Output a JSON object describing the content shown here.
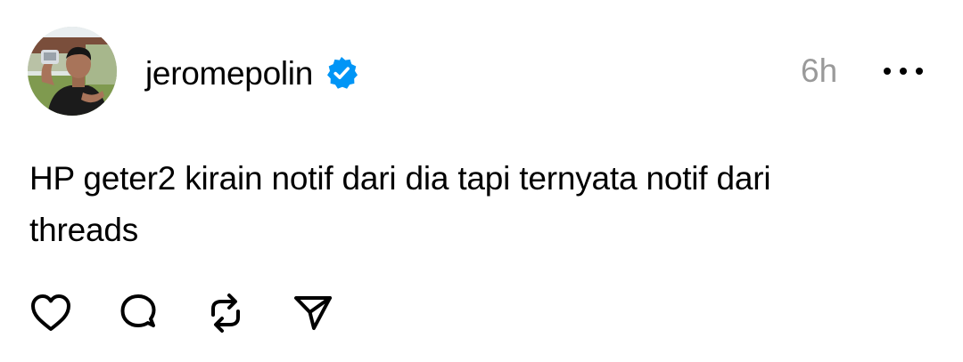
{
  "post": {
    "author": {
      "username": "jeromepolin",
      "verified": true,
      "avatar_icon": "profile-photo"
    },
    "timestamp": "6h",
    "more_icon": "more-horizontal-icon",
    "text": "HP geter2 kirain notif dari dia tapi ternyata notif dari threads",
    "actions": [
      {
        "name": "like",
        "icon": "heart-icon"
      },
      {
        "name": "reply",
        "icon": "comment-icon"
      },
      {
        "name": "repost",
        "icon": "repost-icon"
      },
      {
        "name": "share",
        "icon": "send-icon"
      }
    ]
  },
  "colors": {
    "text": "#000000",
    "muted": "#9a9a9a",
    "verified_blue": "#0095f6",
    "background": "#ffffff"
  }
}
